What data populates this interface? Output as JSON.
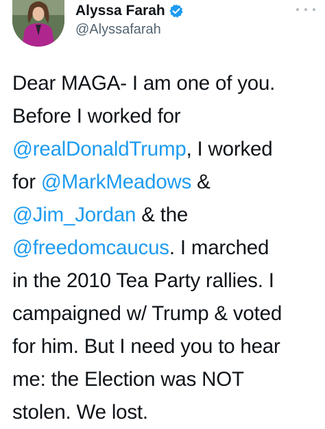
{
  "author": {
    "display_name": "Alyssa Farah",
    "handle": "@Alyssafarah",
    "verified": true,
    "avatar_icon": "profile-photo"
  },
  "colors": {
    "mention": "#1d9bf0",
    "text": "#0f1419",
    "secondary": "#536471",
    "verified_badge": "#1d9bf0"
  },
  "tweet": {
    "lines": [
      [
        {
          "t": "Dear MAGA- I am one of you.",
          "m": false
        }
      ],
      [
        {
          "t": "Before I worked for",
          "m": false
        }
      ],
      [
        {
          "t": "@realDonaldTrump",
          "m": true
        },
        {
          "t": ", I worked",
          "m": false
        }
      ],
      [
        {
          "t": "for ",
          "m": false
        },
        {
          "t": "@MarkMeadows",
          "m": true
        },
        {
          "t": " &",
          "m": false
        }
      ],
      [
        {
          "t": "@Jim_Jordan",
          "m": true
        },
        {
          "t": " & the",
          "m": false
        }
      ],
      [
        {
          "t": "@freedomcaucus",
          "m": true
        },
        {
          "t": ". I marched",
          "m": false
        }
      ],
      [
        {
          "t": "in the 2010 Tea Party rallies. I",
          "m": false
        }
      ],
      [
        {
          "t": "campaigned w/ Trump & voted",
          "m": false
        }
      ],
      [
        {
          "t": "for him. But I need you to hear",
          "m": false
        }
      ],
      [
        {
          "t": "me: the Election was NOT",
          "m": false
        }
      ],
      [
        {
          "t": "stolen. We lost.",
          "m": false
        }
      ]
    ]
  }
}
